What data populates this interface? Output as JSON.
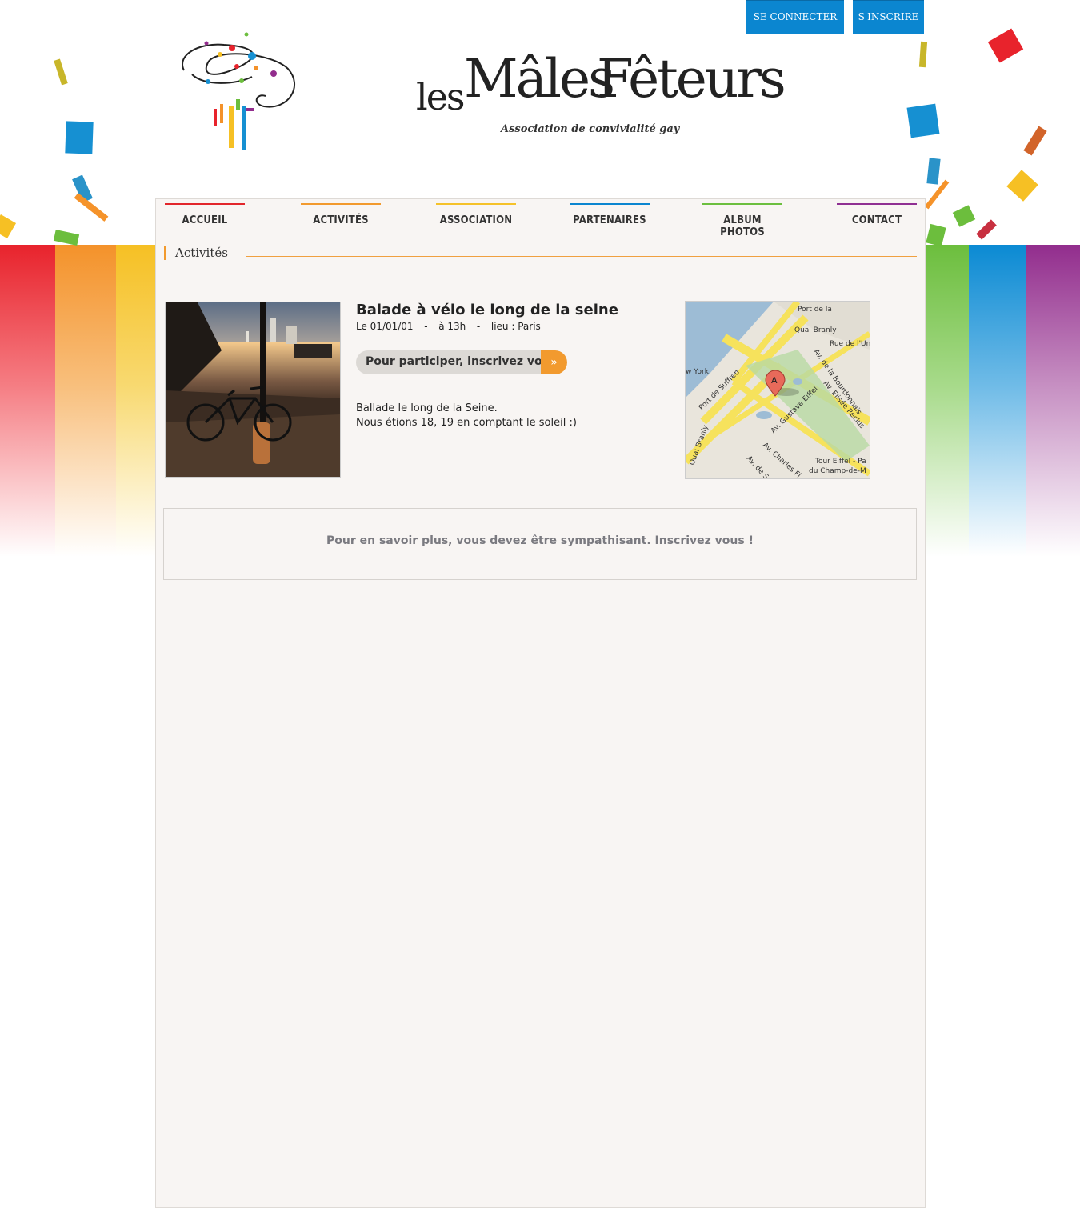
{
  "header": {
    "login_label": "SE CONNECTER",
    "register_label": "S'INSCRIRE"
  },
  "logo": {
    "part_les": "les",
    "part_males": "Mâles",
    "part_feteurs": "Fêteurs",
    "tagline": "Association de convivialité gay"
  },
  "nav": {
    "items": [
      {
        "label": "ACCUEIL",
        "color": "#e2262b"
      },
      {
        "label": "ACTIVITÉS",
        "color": "#f29a2e"
      },
      {
        "label": "ASSOCIATION",
        "color": "#f5c22a"
      },
      {
        "label": "PARTENAIRES",
        "color": "#0b86d0"
      },
      {
        "label": "ALBUM PHOTOS",
        "color": "#6cbf3f"
      },
      {
        "label": "CONTACT",
        "color": "#8f2f92"
      }
    ]
  },
  "section": {
    "title": "Activités"
  },
  "event": {
    "title": "Balade à vélo le long de la seine",
    "date": "Le 01/01/01",
    "time": "à 13h",
    "place": "lieu : Paris",
    "cta_label": "Pour participer, inscrivez vous",
    "description_line1": "Ballade le long de la Seine.",
    "description_line2": "Nous étions 18, 19 en comptant le soleil :)"
  },
  "map": {
    "labels": [
      "Port de la",
      "Quai Branly",
      "Rue de l'Univ",
      "w York",
      "Port de Suffren",
      "Av. de la Bourdonnais",
      "Av. Elisée Reclus",
      "Av. Gustave Eiffel",
      "Quai Branly",
      "Av. Charles Fl",
      "Av. de Suffr",
      "Tour Eiffel - Pa",
      "du Champ-de-M"
    ],
    "marker": "A"
  },
  "notice": {
    "text": "Pour en savoir plus, vous devez être sympathisant. Inscrivez vous !"
  },
  "colors": {
    "accent_orange": "#f29a2e",
    "button_blue": "#0b86d0",
    "panel_bg": "#f8f5f3"
  }
}
